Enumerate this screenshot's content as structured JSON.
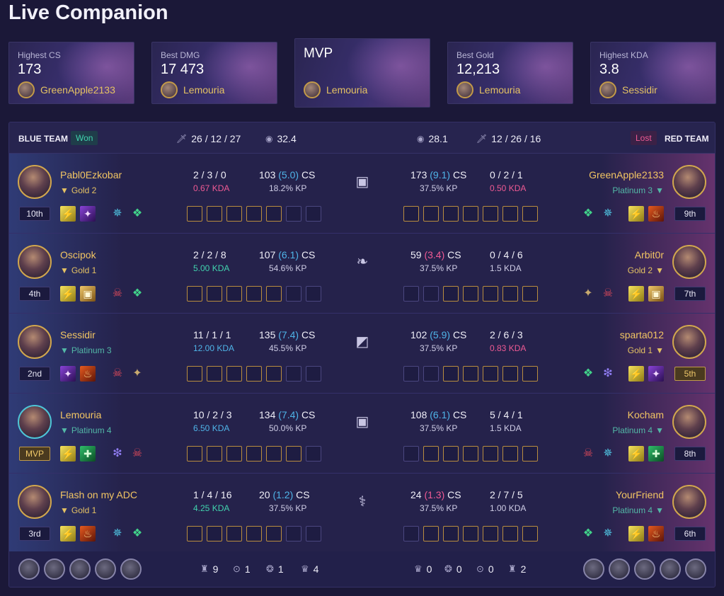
{
  "app": {
    "title": "Live Companion"
  },
  "highlights": [
    {
      "label": "Highest CS",
      "value": "173",
      "player": "GreenApple2133"
    },
    {
      "label": "Best DMG",
      "value": "17 473",
      "player": "Lemouria"
    },
    {
      "label": "MVP",
      "value": "",
      "player": "Lemouria"
    },
    {
      "label": "Best Gold",
      "value": "12,213",
      "player": "Lemouria"
    },
    {
      "label": "Highest KDA",
      "value": "3.8",
      "player": "Sessidir"
    }
  ],
  "blue": {
    "team_name": "BLUE TEAM",
    "result": "Won",
    "kda": "26 / 12 / 27",
    "gold": "32.4",
    "objectives": {
      "towers": "9",
      "dragons": "1",
      "barons": "1",
      "heralds": "4"
    },
    "players": [
      {
        "name": "Pabl0Ezkobar",
        "rank": "Gold 2",
        "position": "10th",
        "kda": "2 / 3 / 0",
        "kda_ratio": "0.67 KDA",
        "cs": "103",
        "cs_min": "(5.0)",
        "cs_suffix": "CS",
        "kp": "18.2% KP",
        "spells": [
          "flash",
          "smite"
        ],
        "runes": [
          "inspiration",
          "resolve"
        ],
        "items": 5
      },
      {
        "name": "Oscipok",
        "rank": "Gold 1",
        "position": "4th",
        "kda": "2 / 2 / 8",
        "kda_ratio": "5.00 KDA",
        "cs": "107",
        "cs_min": "(6.1)",
        "cs_suffix": "CS",
        "kp": "54.6% KP",
        "spells": [
          "flash",
          "barrier"
        ],
        "runes": [
          "domination",
          "resolve"
        ],
        "items": 5
      },
      {
        "name": "Sessidir",
        "rank": "Platinum 3",
        "position": "2nd",
        "kda": "11 / 1 / 1",
        "kda_ratio": "12.00 KDA",
        "cs": "135",
        "cs_min": "(7.4)",
        "cs_suffix": "CS",
        "kp": "45.5% KP",
        "spells": [
          "smite",
          "ignite"
        ],
        "runes": [
          "domination",
          "precision"
        ],
        "items": 5
      },
      {
        "name": "Lemouria",
        "rank": "Platinum 4",
        "position": "MVP",
        "kda": "10 / 2 / 3",
        "kda_ratio": "6.50 KDA",
        "cs": "134",
        "cs_min": "(7.4)",
        "cs_suffix": "CS",
        "kp": "50.0% KP",
        "spells": [
          "flash",
          "heal"
        ],
        "runes": [
          "sorcery",
          "domination"
        ],
        "items": 6
      },
      {
        "name": "Flash on my ADC",
        "rank": "Gold 1",
        "position": "3rd",
        "kda": "1 / 4 / 16",
        "kda_ratio": "4.25 KDA",
        "cs": "20",
        "cs_min": "(1.2)",
        "cs_suffix": "CS",
        "kp": "37.5% KP",
        "spells": [
          "flash",
          "ignite"
        ],
        "runes": [
          "inspiration",
          "resolve"
        ],
        "items": 5
      }
    ]
  },
  "red": {
    "team_name": "RED TEAM",
    "result": "Lost",
    "kda": "12 / 26 / 16",
    "gold": "28.1",
    "objectives": {
      "towers": "2",
      "dragons": "0",
      "barons": "0",
      "heralds": "0"
    },
    "players": [
      {
        "name": "GreenApple2133",
        "rank": "Platinum 3",
        "position": "9th",
        "kda": "0 / 2 / 1",
        "kda_ratio": "0.50 KDA",
        "cs": "173",
        "cs_min": "(9.1)",
        "cs_suffix": "CS",
        "kp": "37.5% KP",
        "spells": [
          "flash",
          "ignite"
        ],
        "runes": [
          "resolve",
          "inspiration"
        ],
        "items": 7
      },
      {
        "name": "Arbit0r",
        "rank": "Gold 2",
        "position": "7th",
        "kda": "0 / 4 / 6",
        "kda_ratio": "1.5 KDA",
        "cs": "59",
        "cs_min": "(3.4)",
        "cs_suffix": "CS",
        "kp": "37.5% KP",
        "spells": [
          "flash",
          "barrier"
        ],
        "runes": [
          "precision",
          "domination"
        ],
        "items": 5
      },
      {
        "name": "sparta012",
        "rank": "Gold 1",
        "position": "5th",
        "kda": "2 / 6 / 3",
        "kda_ratio": "0.83 KDA",
        "cs": "102",
        "cs_min": "(5.9)",
        "cs_suffix": "CS",
        "kp": "37.5% KP",
        "spells": [
          "flash",
          "smite"
        ],
        "runes": [
          "resolve",
          "sorcery"
        ],
        "items": 5
      },
      {
        "name": "Kocham",
        "rank": "Platinum 4",
        "position": "8th",
        "kda": "5 / 4 / 1",
        "kda_ratio": "1.5 KDA",
        "cs": "108",
        "cs_min": "(6.1)",
        "cs_suffix": "CS",
        "kp": "37.5% KP",
        "spells": [
          "flash",
          "heal"
        ],
        "runes": [
          "domination",
          "inspiration"
        ],
        "items": 6
      },
      {
        "name": "YourFriend",
        "rank": "Platinum 4",
        "position": "6th",
        "kda": "2 / 7 / 5",
        "kda_ratio": "1.00 KDA",
        "cs": "24",
        "cs_min": "(1.3)",
        "cs_suffix": "CS",
        "kp": "37.5% KP",
        "spells": [
          "flash",
          "ignite"
        ],
        "runes": [
          "resolve",
          "inspiration"
        ],
        "items": 6
      }
    ]
  },
  "colors": {
    "gold_text": "#f2c563",
    "won": "#41d3ae",
    "lost": "#ef5a94",
    "cs_per_min_blue": "#4fb4e8",
    "kda_good": "#41d3ae",
    "kda_great": "#4fb4e8",
    "kda_bad": "#ef5a94"
  },
  "icons": {
    "kda": "sword-icon",
    "gold": "coins-icon",
    "tower": "tower-icon",
    "dragon": "dragon-icon",
    "baron": "baron-icon",
    "herald": "herald-icon"
  }
}
